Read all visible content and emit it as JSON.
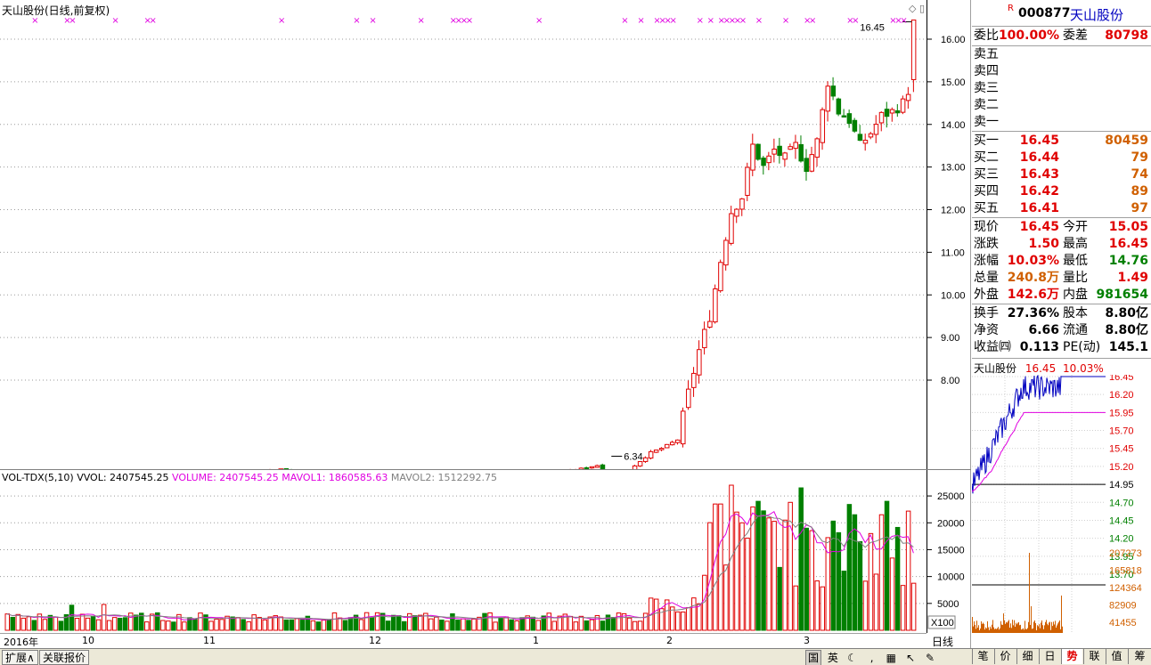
{
  "chart_title": "天山股份(日线,前复权)",
  "chart_controls": [
    "◇",
    "▯"
  ],
  "price_axis": [
    "16.00",
    "15.00",
    "14.00",
    "13.00",
    "12.00",
    "11.00",
    "10.00",
    "9.00",
    "8.00"
  ],
  "high_marker": "16.45",
  "low_marker": "6.34",
  "volume_legend": {
    "name": "VOL-TDX(5,10)",
    "vvol": "VVOL: 2407545.25",
    "volume": "VOLUME: 2407545.25",
    "mavol1": "MAVOL1: 1860585.63",
    "mavol2": "MAVOL2: 1512292.75"
  },
  "volume_axis": [
    "25000",
    "20000",
    "15000",
    "10000",
    "5000"
  ],
  "volume_unit": "X100",
  "date_ticks": [
    "2016年",
    "10",
    "11",
    "12",
    "1",
    "2",
    "3"
  ],
  "period": "日线",
  "bottom_tabs": [
    "扩展∧",
    "关联报价"
  ],
  "toolbar_icons": [
    "国",
    "英",
    "moon-icon",
    "comma-icon",
    "grid-icon",
    "arrow-icon",
    "wrench-icon"
  ],
  "toolbar_glyphs": [
    "国",
    "英",
    "☾",
    "‚",
    "▦",
    "↖",
    "✎"
  ],
  "quote": {
    "flag": "R",
    "code": "000877",
    "name": "天山股份",
    "weibi_label": "委比",
    "weibi": "100.00%",
    "weicha_label": "委差",
    "weicha": "80798",
    "sell": [
      {
        "label": "卖五"
      },
      {
        "label": "卖四"
      },
      {
        "label": "卖三"
      },
      {
        "label": "卖二"
      },
      {
        "label": "卖一"
      }
    ],
    "buy": [
      {
        "label": "买一",
        "price": "16.45",
        "vol": "80459"
      },
      {
        "label": "买二",
        "price": "16.44",
        "vol": "79"
      },
      {
        "label": "买三",
        "price": "16.43",
        "vol": "74"
      },
      {
        "label": "买四",
        "price": "16.42",
        "vol": "89"
      },
      {
        "label": "买五",
        "price": "16.41",
        "vol": "97"
      }
    ],
    "stats": [
      {
        "l1": "现价",
        "v1": "16.45",
        "c1": "red",
        "l2": "今开",
        "v2": "15.05",
        "c2": "red"
      },
      {
        "l1": "涨跌",
        "v1": "1.50",
        "c1": "red",
        "l2": "最高",
        "v2": "16.45",
        "c2": "red"
      },
      {
        "l1": "涨幅",
        "v1": "10.03%",
        "c1": "red",
        "l2": "最低",
        "v2": "14.76",
        "c2": "green"
      },
      {
        "l1": "总量",
        "v1": "240.8万",
        "c1": "orange",
        "l2": "量比",
        "v2": "1.49",
        "c2": "red"
      },
      {
        "l1": "外盘",
        "v1": "142.6万",
        "c1": "red",
        "l2": "内盘",
        "v2": "981654",
        "c2": "green"
      }
    ],
    "fund": [
      {
        "l1": "换手",
        "v1": "27.36%",
        "l2": "股本",
        "v2": "8.80亿"
      },
      {
        "l1": "净资",
        "v1": "6.66",
        "l2": "流通",
        "v2": "8.80亿"
      },
      {
        "l1": "收益㈣",
        "v1": "0.113",
        "l2": "PE(动)",
        "v2": "145.1"
      }
    ]
  },
  "mini_chart": {
    "title": "天山股份",
    "price": "16.45",
    "pct": "10.03%",
    "price_axis": [
      "16.45",
      "16.20",
      "15.95",
      "15.70",
      "15.45",
      "15.20",
      "14.95",
      "14.70",
      "14.45",
      "14.20",
      "13.95",
      "13.70"
    ],
    "vol_axis": [
      "207273",
      "165818",
      "124364",
      "82909",
      "41455"
    ]
  },
  "right_tabs": [
    "笔",
    "价",
    "细",
    "日",
    "势",
    "联",
    "值",
    "筹"
  ],
  "right_tab_active": "势",
  "colors": {
    "up": "#e00000",
    "down": "#008000",
    "ma1": "#e000e0",
    "ma2": "#808080",
    "line": "#0000c0"
  }
}
